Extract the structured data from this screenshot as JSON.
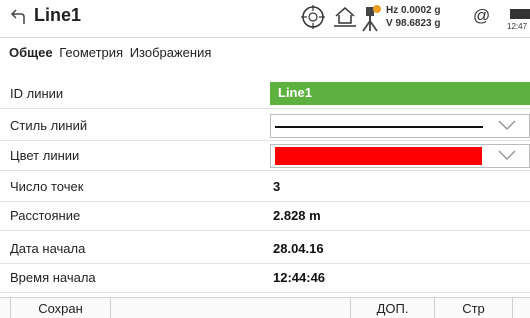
{
  "header": {
    "title": "Line1",
    "hz_reading": "Hz 0.0002 g",
    "v_reading": "V  98.6823 g",
    "at_symbol": "@",
    "clock": "12:47",
    "icons": [
      "back-arrow-icon",
      "crosshair-target-icon",
      "home-icon",
      "instrument-warning-icon",
      "battery-icon"
    ],
    "warning_color": "#f0a020"
  },
  "tabs": [
    {
      "label": "Общее",
      "active": true
    },
    {
      "label": "Геометрия",
      "active": false
    },
    {
      "label": "Изображения",
      "active": false
    }
  ],
  "fields": {
    "line_id": {
      "label": "ID линии",
      "value": "Line1",
      "color": "#5cb13f"
    },
    "line_style": {
      "label": "Стиль линий"
    },
    "line_color": {
      "label": "Цвет линии",
      "swatch_color": "#ff0000"
    },
    "point_count": {
      "label": "Число точек",
      "value": "3"
    },
    "distance": {
      "label": "Расстояние",
      "value": "2.828 m"
    },
    "start_date": {
      "label": "Дата начала",
      "value": "28.04.16"
    },
    "start_time": {
      "label": "Время начала",
      "value": "12:44:46"
    }
  },
  "toolbar": {
    "save_label": "Сохран",
    "more_label": "ДОП.",
    "page_label": "Стр"
  }
}
